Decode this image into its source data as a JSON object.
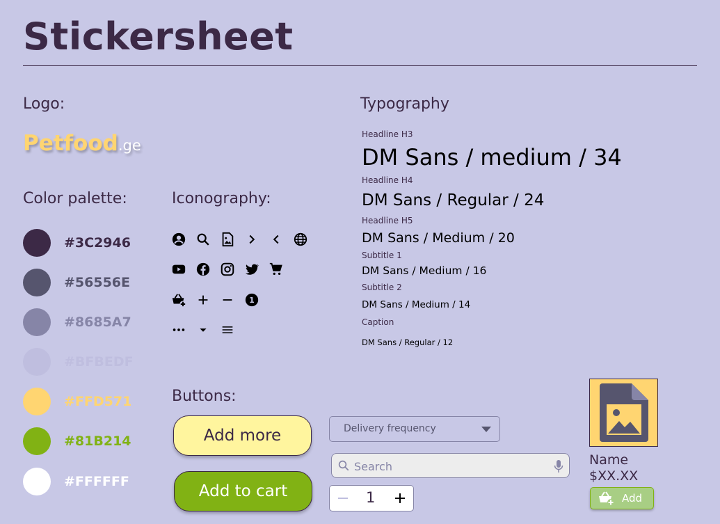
{
  "title": "Stickersheet",
  "logo": {
    "label": "Logo:",
    "brand": "Petfood",
    "tld": ".ge"
  },
  "palette": {
    "label": "Color palette:",
    "colors": [
      {
        "hex": "#3C2946",
        "label": "#3C2946",
        "text_color": "#3C2946"
      },
      {
        "hex": "#56556E",
        "label": "#56556E",
        "text_color": "#56556E"
      },
      {
        "hex": "#8685A7",
        "label": "#8685A7",
        "text_color": "#8685A7"
      },
      {
        "hex": "#BFBEDF",
        "label": "#BFBEDF",
        "text_color": "#BFBEDF"
      },
      {
        "hex": "#FFD571",
        "label": "#FFD571",
        "text_color": "#FFD571"
      },
      {
        "hex": "#81B214",
        "label": "#81B214",
        "text_color": "#81B214"
      },
      {
        "hex": "#FFFFFF",
        "label": "#FFFFFF",
        "text_color": "#FFFFFF"
      }
    ]
  },
  "iconography": {
    "label": "Iconography:",
    "rows": [
      [
        "account-circle-icon",
        "search-icon",
        "image-file-icon",
        "chevron-right-icon",
        "chevron-left-icon",
        "globe-icon"
      ],
      [
        "youtube-icon",
        "facebook-icon",
        "instagram-icon",
        "twitter-icon",
        "shopping-cart-icon"
      ],
      [
        "add-to-basket-icon",
        "plus-icon",
        "minus-icon",
        "number-one-badge-icon"
      ],
      [
        "more-horizontal-icon",
        "caret-down-icon",
        "menu-icon"
      ]
    ],
    "badge_number": "1"
  },
  "typography": {
    "label": "Typography",
    "styles": [
      {
        "label": "Headline H3",
        "sample": "DM Sans / medium / 34"
      },
      {
        "label": "Headline H4",
        "sample": "DM Sans / Regular / 24"
      },
      {
        "label": "Headline H5",
        "sample": "DM Sans / Medium / 20"
      },
      {
        "label": "Subtitle 1",
        "sample": "DM Sans / Medium / 16"
      },
      {
        "label": "Subtitle 2",
        "sample": "DM Sans / Medium / 14"
      },
      {
        "label": "Caption",
        "sample": "DM Sans / Regular / 12"
      }
    ]
  },
  "buttons": {
    "label": "Buttons:",
    "add_more": "Add more",
    "add_to_cart": "Add to cart",
    "dropdown_label": "Delivery frequency",
    "search_placeholder": "Search",
    "stepper_value": "1"
  },
  "product": {
    "name": "Name",
    "price": "$XX.XX",
    "add_label": "Add"
  },
  "colors": {
    "background": "#C8C8E6",
    "primary": "#3C2946",
    "accent_yellow": "#FFD571",
    "button_yellow": "#FFF59E",
    "accent_green": "#81B214"
  }
}
